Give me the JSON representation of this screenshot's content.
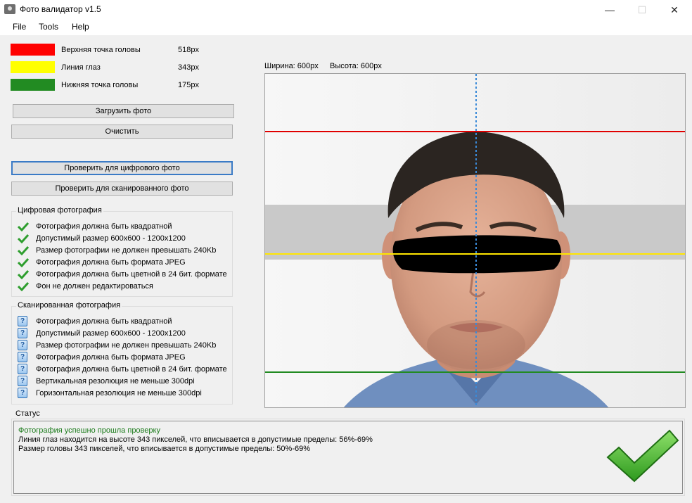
{
  "window": {
    "title": "Фото валидатор v1.5",
    "min": "—",
    "max": "☐",
    "close": "✕"
  },
  "menu": [
    "File",
    "Tools",
    "Help"
  ],
  "legend": [
    {
      "label": "Верхняя точка головы",
      "value": "518px",
      "color": "#ff0000"
    },
    {
      "label": "Линия глаз",
      "value": "343px",
      "color": "#ffff00"
    },
    {
      "label": "Нижняя точка головы",
      "value": "175px",
      "color": "#228b22"
    }
  ],
  "buttons": {
    "load": "Загрузить фото",
    "clear": "Очистить",
    "check_digital": "Проверить для цифрового фото",
    "check_scanned": "Проверить для сканированного фото"
  },
  "digital": {
    "title": "Цифровая фотография",
    "items": [
      "Фотография должна быть квадратной",
      "Допустимый размер 600x600 - 1200x1200",
      "Размер фотографии не должен превышать 240Kb",
      "Фотография должна быть формата JPEG",
      "Фотография должна быть цветной в 24 бит. формате",
      "Фон не должен редактироваться"
    ]
  },
  "scanned": {
    "title": "Сканированная фотография",
    "items": [
      "Фотография должна быть квадратной",
      "Допустимый размер 600x600 - 1200x1200",
      "Размер фотографии не должен превышать 240Kb",
      "Фотография должна быть формата JPEG",
      "Фотография должна быть цветной в 24 бит. формате",
      "Вертикальная резолюция не меньше 300dpi",
      "Горизонтальная резолюция не меньше 300dpi"
    ]
  },
  "image_info": {
    "width": "Ширина: 600px",
    "height": "Высота: 600px"
  },
  "status": {
    "title": "Статус",
    "lines": [
      "Фотография успешно прошла проверку",
      "Линия глаз находится на высоте 343 пикселей, что вписывается в допустимые пределы: 56%-69%",
      "Размер головы 343 пикселей, что вписывается в допустимые пределы: 50%-69%"
    ],
    "success_color": "#1a7a1a"
  },
  "icons": {
    "check": "check-icon",
    "question": "question-icon",
    "app": "camera-icon",
    "success": "big-check-icon"
  }
}
